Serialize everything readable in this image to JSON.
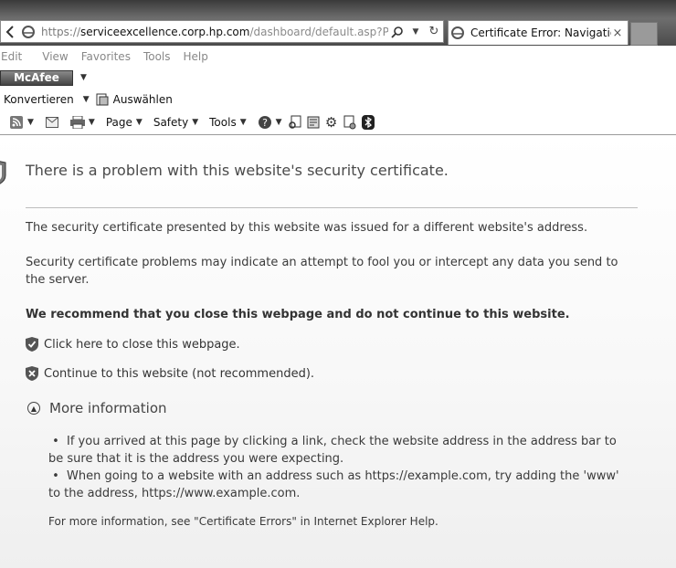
{
  "browser": {
    "url": {
      "scheme": "https://",
      "host": "serviceexcellence.corp.hp.com",
      "path": "/dashboard/default.asp?PAGE=org"
    },
    "tab_title": "Certificate Error: Navigation...",
    "tab_close": "×",
    "menu": [
      "Edit",
      "View",
      "Favorites",
      "Tools",
      "Help"
    ],
    "mcafee_label": "McAfee",
    "convert_label": "Konvertieren",
    "select_label": "Auswählen",
    "command_bar": {
      "page_label": "Page",
      "safety_label": "Safety",
      "tools_label": "Tools"
    }
  },
  "page": {
    "heading": "There is a problem with this website's security certificate.",
    "paragraph_1": "The security certificate presented by this website was issued for a different website's address.",
    "paragraph_2": "Security certificate problems may indicate an attempt to fool you or intercept any data you send to the server.",
    "recommendation": "We recommend that you close this webpage and do not continue to this website.",
    "close_link": "Click here to close this webpage.",
    "continue_link": "Continue to this website (not recommended).",
    "more_info_label": "More information",
    "info_items": [
      "If you arrived at this page by clicking a link, check the website address in the address bar to be sure that it is the address you were expecting.",
      "When going to a website with an address such as https://example.com, try adding the 'www' to the address, https://www.example.com."
    ],
    "help_note": "For more information, see \"Certificate Errors\" in Internet Explorer Help."
  },
  "icons": [
    "ie-page-icon",
    "search-icon",
    "dropdown-arrow-icon",
    "refresh-icon",
    "rss-icon",
    "mail-icon",
    "print-icon",
    "help-icon",
    "shield-icon",
    "gear-icon",
    "bluetooth-icon"
  ],
  "colors": {
    "chrome_dark": "#3a3a3a",
    "page_bg": "#ffffff",
    "text": "#3a3a3a"
  }
}
